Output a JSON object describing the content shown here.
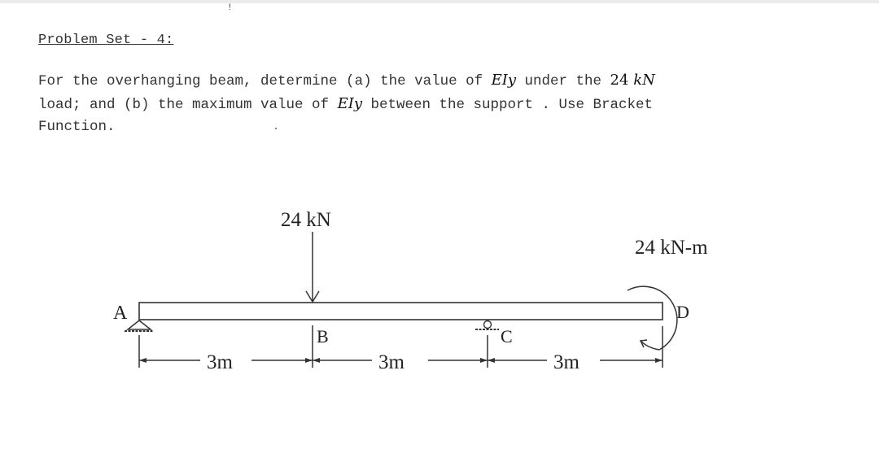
{
  "heading": "Problem Set - 4:",
  "stray_mark": "!",
  "problem": {
    "t1": "For the overhanging beam, determine (a) the value of ",
    "m1": "EIy",
    "t2": " under the ",
    "m2_num": "24 ",
    "m2_unit": "kN",
    "t3": "\nload; and (b) the maximum value of ",
    "m3": "EIy",
    "t4": " between the support . Use Bracket\nFunction."
  },
  "figure": {
    "point_load_label": "24 kN",
    "moment_label": "24 kN-m",
    "points": {
      "A": "A",
      "B": "B",
      "C": "C",
      "D": "D"
    },
    "spans": [
      "3m",
      "3m",
      "3m"
    ]
  }
}
